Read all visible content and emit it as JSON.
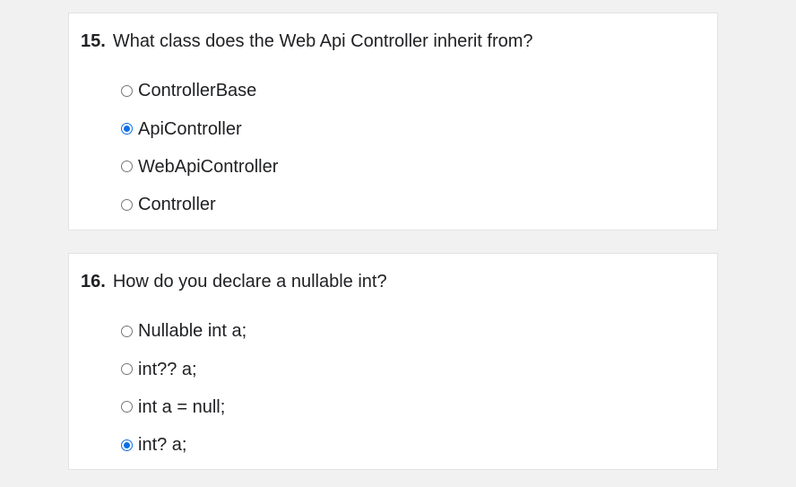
{
  "theme": {
    "accent": "#0b6fe6",
    "page_bg": "#f1f1f1",
    "card_bg": "#ffffff"
  },
  "questions": [
    {
      "number": "15.",
      "text": "What class does the Web Api Controller inherit from?",
      "options": [
        {
          "label": "ControllerBase",
          "checked": false
        },
        {
          "label": "ApiController",
          "checked": true
        },
        {
          "label": "WebApiController",
          "checked": false
        },
        {
          "label": "Controller",
          "checked": false
        }
      ]
    },
    {
      "number": "16.",
      "text": "How do you declare a nullable int?",
      "options": [
        {
          "label": "Nullable int a;",
          "checked": false
        },
        {
          "label": "int?? a;",
          "checked": false
        },
        {
          "label": "int a = null;",
          "checked": false
        },
        {
          "label": "int? a;",
          "checked": true
        }
      ]
    }
  ]
}
